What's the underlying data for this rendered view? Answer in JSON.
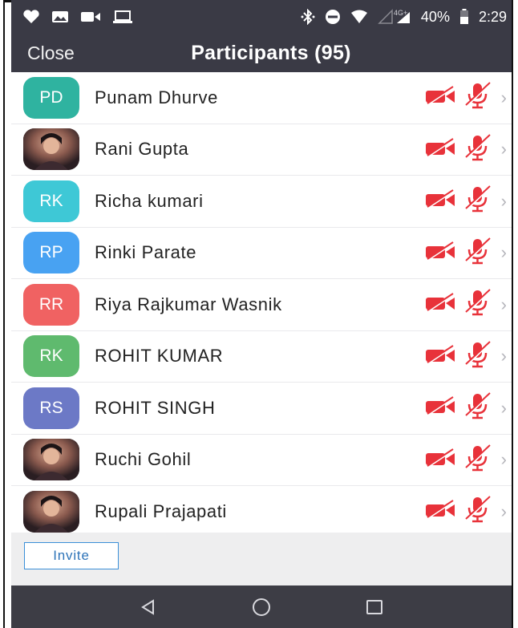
{
  "status_bar": {
    "network": "4G+",
    "battery_percent": "40%",
    "time": "2:29"
  },
  "header": {
    "close_label": "Close",
    "title": "Participants (95)"
  },
  "participants": [
    {
      "initials": "PD",
      "name": "Punam Dhurve",
      "avatar_color": "#2fb3a0",
      "photo": false
    },
    {
      "initials": "",
      "name": "Rani Gupta",
      "avatar_color": "#5a3a3a",
      "photo": true
    },
    {
      "initials": "RK",
      "name": "Richa kumari",
      "avatar_color": "#3ec8d6",
      "photo": false
    },
    {
      "initials": "RP",
      "name": "Rinki Parate",
      "avatar_color": "#48a2f2",
      "photo": false
    },
    {
      "initials": "RR",
      "name": "Riya Rajkumar Wasnik",
      "avatar_color": "#f06262",
      "photo": false
    },
    {
      "initials": "RK",
      "name": "ROHIT KUMAR",
      "avatar_color": "#5fba6e",
      "photo": false
    },
    {
      "initials": "RS",
      "name": "ROHIT SINGH",
      "avatar_color": "#6c79c6",
      "photo": false
    },
    {
      "initials": "",
      "name": "Ruchi Gohil",
      "avatar_color": "#2a2a2a",
      "photo": true
    },
    {
      "initials": "",
      "name": "Rupali Prajapati",
      "avatar_color": "#7a5a66",
      "photo": true
    }
  ],
  "footer": {
    "invite_label": "Invite"
  },
  "colors": {
    "bar_background": "#3a3a45",
    "muted_red": "#e8323a",
    "invite_blue": "#3b8fd8"
  }
}
